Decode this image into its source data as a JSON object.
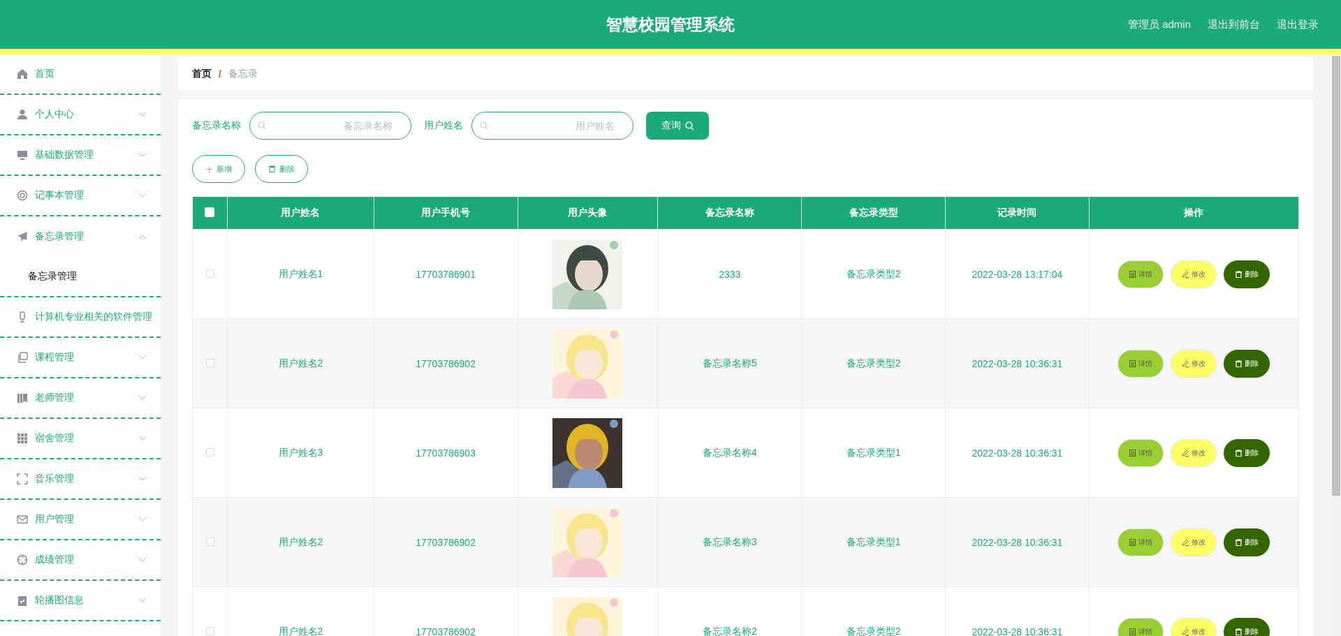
{
  "header": {
    "title": "智慧校园管理系统",
    "links": [
      "管理员 admin",
      "退出到前台",
      "退出登录"
    ]
  },
  "sidebar": {
    "items": [
      {
        "label": "首页",
        "kind": "link"
      },
      {
        "label": "个人中心",
        "kind": "menu",
        "expanded": false
      },
      {
        "label": "基础数据管理",
        "kind": "menu",
        "expanded": false
      },
      {
        "label": "记事本管理",
        "kind": "menu",
        "expanded": false
      },
      {
        "label": "备忘录管理",
        "kind": "menu",
        "expanded": true,
        "children": [
          {
            "label": "备忘录管理"
          }
        ]
      },
      {
        "label": "计算机专业相关的软件管理",
        "kind": "link"
      },
      {
        "label": "课程管理",
        "kind": "menu",
        "expanded": false
      },
      {
        "label": "老师管理",
        "kind": "menu",
        "expanded": false
      },
      {
        "label": "宿舍管理",
        "kind": "menu",
        "expanded": false
      },
      {
        "label": "音乐管理",
        "kind": "menu",
        "expanded": false
      },
      {
        "label": "用户管理",
        "kind": "menu",
        "expanded": false
      },
      {
        "label": "成绩管理",
        "kind": "menu",
        "expanded": false
      },
      {
        "label": "轮播图信息",
        "kind": "menu",
        "expanded": false
      }
    ]
  },
  "breadcrumb": [
    "首页",
    "/",
    "备忘录"
  ],
  "search": {
    "fields": [
      {
        "label": "备忘录名称",
        "placeholder": "备忘录名称"
      },
      {
        "label": "用户姓名",
        "placeholder": "用户姓名"
      }
    ],
    "button": "查询"
  },
  "toolbar": [
    "新增",
    "删除"
  ],
  "table": {
    "select_all_checked": false,
    "columns": [
      "用户姓名",
      "用户手机号",
      "用户头像",
      "备忘录名称",
      "备忘录类型",
      "记录时间",
      "操作"
    ],
    "rows": [
      {
        "checked": false,
        "cells": [
          "用户姓名1",
          "17703786901",
          {
            "kind": "picture"
          },
          "2333",
          "备忘录类型2",
          "2022-03-28 13:17:04",
          {
            "actions": [
              "详情",
              "修改",
              "删除"
            ]
          }
        ]
      },
      {
        "checked": false,
        "cells": [
          "用户姓名2",
          "17703786902",
          {
            "kind": "picture"
          },
          "备忘录名称5",
          "备忘录类型2",
          "2022-03-28 10:36:31",
          {
            "actions": [
              "详情",
              "修改",
              "删除"
            ]
          }
        ]
      },
      {
        "checked": false,
        "cells": [
          "用户姓名3",
          "17703786903",
          {
            "kind": "picture"
          },
          "备忘录名称4",
          "备忘录类型1",
          "2022-03-28 10:36:31",
          {
            "actions": [
              "详情",
              "修改",
              "删除"
            ]
          }
        ]
      },
      {
        "checked": false,
        "cells": [
          "用户姓名2",
          "17703786902",
          {
            "kind": "picture"
          },
          "备忘录名称3",
          "备忘录类型1",
          "2022-03-28 10:36:31",
          {
            "actions": [
              "详情",
              "修改",
              "删除"
            ]
          }
        ]
      },
      {
        "checked": false,
        "cells": [
          "用户姓名2",
          "17703786902",
          {
            "kind": "picture"
          },
          "备忘录名称2",
          "备忘录类型2",
          "2022-03-28 10:36:31",
          {
            "actions": [
              "详情",
              "修改",
              "删除"
            ]
          }
        ]
      }
    ]
  }
}
